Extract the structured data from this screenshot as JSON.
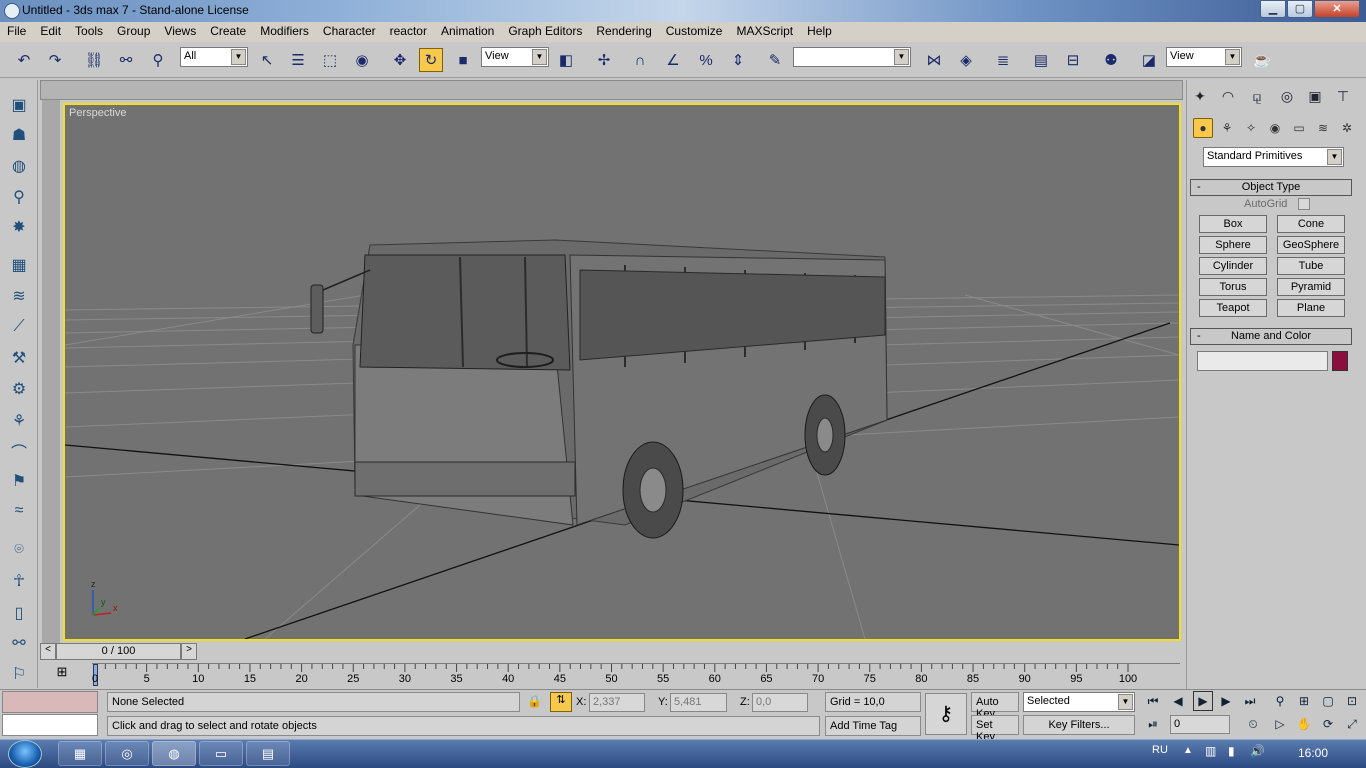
{
  "window": {
    "title": "Untitled - 3ds max 7 - Stand-alone License",
    "min": "▁",
    "max": "▢",
    "close": "✕"
  },
  "menu": [
    "File",
    "Edit",
    "Tools",
    "Group",
    "Views",
    "Create",
    "Modifiers",
    "Character",
    "reactor",
    "Animation",
    "Graph Editors",
    "Rendering",
    "Customize",
    "MAXScript",
    "Help"
  ],
  "toolbar": {
    "selection_filter": "All",
    "ref_coord": "View",
    "named_selection": "",
    "render_dd": "View",
    "icons": [
      "undo-icon",
      "redo-icon",
      "select-link-icon",
      "unlink-icon",
      "bind-spacewarp-icon",
      "select-icon",
      "select-by-name-icon",
      "rect-region-icon",
      "window-crossing-icon",
      "move-icon",
      "rotate-icon",
      "scale-icon",
      "pivot-icon",
      "manipulate-icon",
      "snap-3d-icon",
      "angle-snap-icon",
      "percent-snap-icon",
      "spinner-snap-icon",
      "edit-named-selection-icon",
      "mirror-icon",
      "align-icon",
      "layer-manager-icon",
      "curve-editor-icon",
      "schematic-icon",
      "material-editor-icon",
      "render-scene-icon",
      "quick-render-icon"
    ]
  },
  "viewport": {
    "label": "Perspective",
    "axes": {
      "z": "z",
      "x": "x",
      "y": "y"
    }
  },
  "command_panel": {
    "category": "Standard Primitives",
    "object_type_title": "Object Type",
    "autogrid_label": "AutoGrid",
    "buttons": [
      "Box",
      "Cone",
      "Sphere",
      "GeoSphere",
      "Cylinder",
      "Tube",
      "Torus",
      "Pyramid",
      "Teapot",
      "Plane"
    ],
    "name_color_title": "Name and Color",
    "name_value": "",
    "color": "#8a0f3e",
    "rollout_minus": "-"
  },
  "timeline": {
    "slider": "0 / 100",
    "ticks": [
      "0",
      "5",
      "10",
      "15",
      "20",
      "25",
      "30",
      "35",
      "40",
      "45",
      "50",
      "55",
      "60",
      "65",
      "70",
      "75",
      "80",
      "85",
      "90",
      "95",
      "100"
    ],
    "prev": "<",
    "next": ">"
  },
  "status": {
    "selection": "None Selected",
    "prompt": "Click and drag to select and rotate objects",
    "x_label": "X:",
    "x_value": "2,337",
    "y_label": "Y:",
    "y_value": "5,481",
    "z_label": "Z:",
    "z_value": "0,0",
    "grid": "Grid = 10,0",
    "add_time_tag": "Add Time Tag",
    "auto_key": "Auto Key",
    "set_key": "Set Key",
    "key_mode": "Selected",
    "key_filters": "Key Filters...",
    "frame": "0"
  },
  "taskbar": {
    "lang": "RU",
    "clock": "16:00"
  }
}
